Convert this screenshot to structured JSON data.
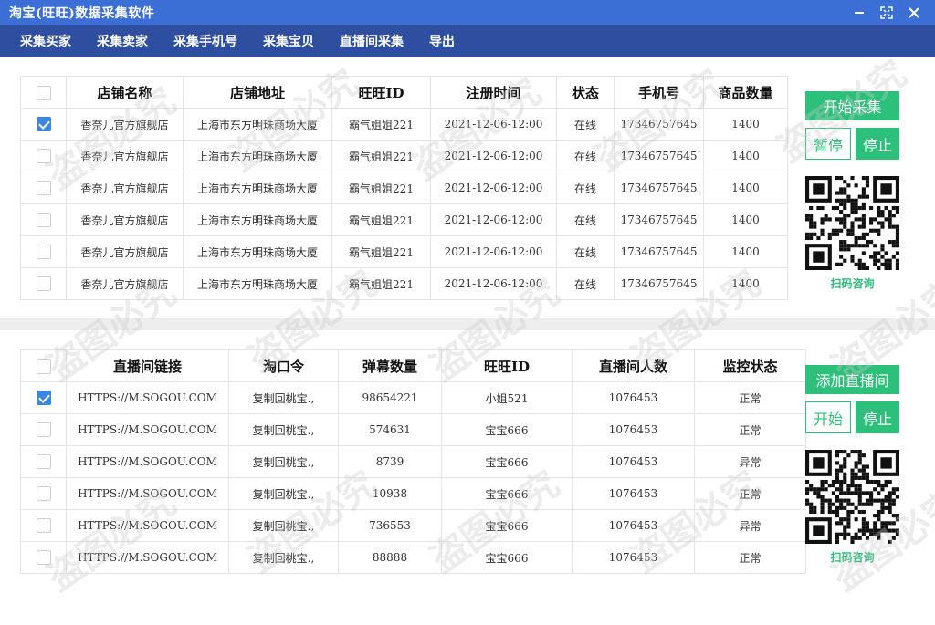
{
  "window": {
    "title": "淘宝(旺旺)数据采集软件"
  },
  "menu": [
    "采集买家",
    "采集卖家",
    "采集手机号",
    "采集宝贝",
    "直播间采集",
    "导出"
  ],
  "shops": {
    "headers": [
      "店铺名称",
      "店铺地址",
      "旺旺ID",
      "注册时间",
      "状态",
      "手机号",
      "商品数量"
    ],
    "rows": [
      {
        "checked": true,
        "name": "香奈儿官方旗舰店",
        "address": "上海市东方明珠商场大厦",
        "wangwang": "霸气姐姐221",
        "time": "2021-12-06-12:00",
        "status": "在线",
        "phone": "17346757645",
        "count": "1400"
      },
      {
        "checked": false,
        "name": "香奈儿官方旗舰店",
        "address": "上海市东方明珠商场大厦",
        "wangwang": "霸气姐姐221",
        "time": "2021-12-06-12:00",
        "status": "在线",
        "phone": "17346757645",
        "count": "1400"
      },
      {
        "checked": false,
        "name": "香奈儿官方旗舰店",
        "address": "上海市东方明珠商场大厦",
        "wangwang": "霸气姐姐221",
        "time": "2021-12-06-12:00",
        "status": "在线",
        "phone": "17346757645",
        "count": "1400"
      },
      {
        "checked": false,
        "name": "香奈儿官方旗舰店",
        "address": "上海市东方明珠商场大厦",
        "wangwang": "霸气姐姐221",
        "time": "2021-12-06-12:00",
        "status": "在线",
        "phone": "17346757645",
        "count": "1400"
      },
      {
        "checked": false,
        "name": "香奈儿官方旗舰店",
        "address": "上海市东方明珠商场大厦",
        "wangwang": "霸气姐姐221",
        "time": "2021-12-06-12:00",
        "status": "在线",
        "phone": "17346757645",
        "count": "1400"
      },
      {
        "checked": false,
        "name": "香奈儿官方旗舰店",
        "address": "上海市东方明珠商场大厦",
        "wangwang": "霸气姐姐221",
        "time": "2021-12-06-12:00",
        "status": "在线",
        "phone": "17346757645",
        "count": "1400"
      }
    ]
  },
  "live": {
    "headers": [
      "直播间链接",
      "淘口令",
      "弹幕数量",
      "旺旺ID",
      "直播间人数",
      "监控状态"
    ],
    "rows": [
      {
        "checked": true,
        "link": "HTTPS://M.SOGOU.COM",
        "code": "复制回桃宝.,",
        "danmu": "98654221",
        "wangwang": "小姐521",
        "viewers": "1076453",
        "status": "正常"
      },
      {
        "checked": false,
        "link": "HTTPS://M.SOGOU.COM",
        "code": "复制回桃宝.,",
        "danmu": "574631",
        "wangwang": "宝宝666",
        "viewers": "1076453",
        "status": "正常"
      },
      {
        "checked": false,
        "link": "HTTPS://M.SOGOU.COM",
        "code": "复制回桃宝.,",
        "danmu": "8739",
        "wangwang": "宝宝666",
        "viewers": "1076453",
        "status": "异常"
      },
      {
        "checked": false,
        "link": "HTTPS://M.SOGOU.COM",
        "code": "复制回桃宝.,",
        "danmu": "10938",
        "wangwang": "宝宝666",
        "viewers": "1076453",
        "status": "正常"
      },
      {
        "checked": false,
        "link": "HTTPS://M.SOGOU.COM",
        "code": "复制回桃宝.,",
        "danmu": "736553",
        "wangwang": "宝宝666",
        "viewers": "1076453",
        "status": "异常"
      },
      {
        "checked": false,
        "link": "HTTPS://M.SOGOU.COM",
        "code": "复制回桃宝.,",
        "danmu": "88888",
        "wangwang": "宝宝666",
        "viewers": "1076453",
        "status": "正常"
      }
    ]
  },
  "controls1": {
    "start": "开始采集",
    "pause": "暂停",
    "stop": "停止",
    "qr_label": "扫码咨询"
  },
  "controls2": {
    "add": "添加直播间",
    "start": "开始",
    "stop": "停止",
    "qr_label": "扫码咨询"
  },
  "watermark": "盗图必究",
  "colors": {
    "titlebar": "#3b6fd6",
    "menubar": "#2e4f9f",
    "accent_green": "#2cc07a",
    "checkbox_blue": "#3b86e0"
  }
}
